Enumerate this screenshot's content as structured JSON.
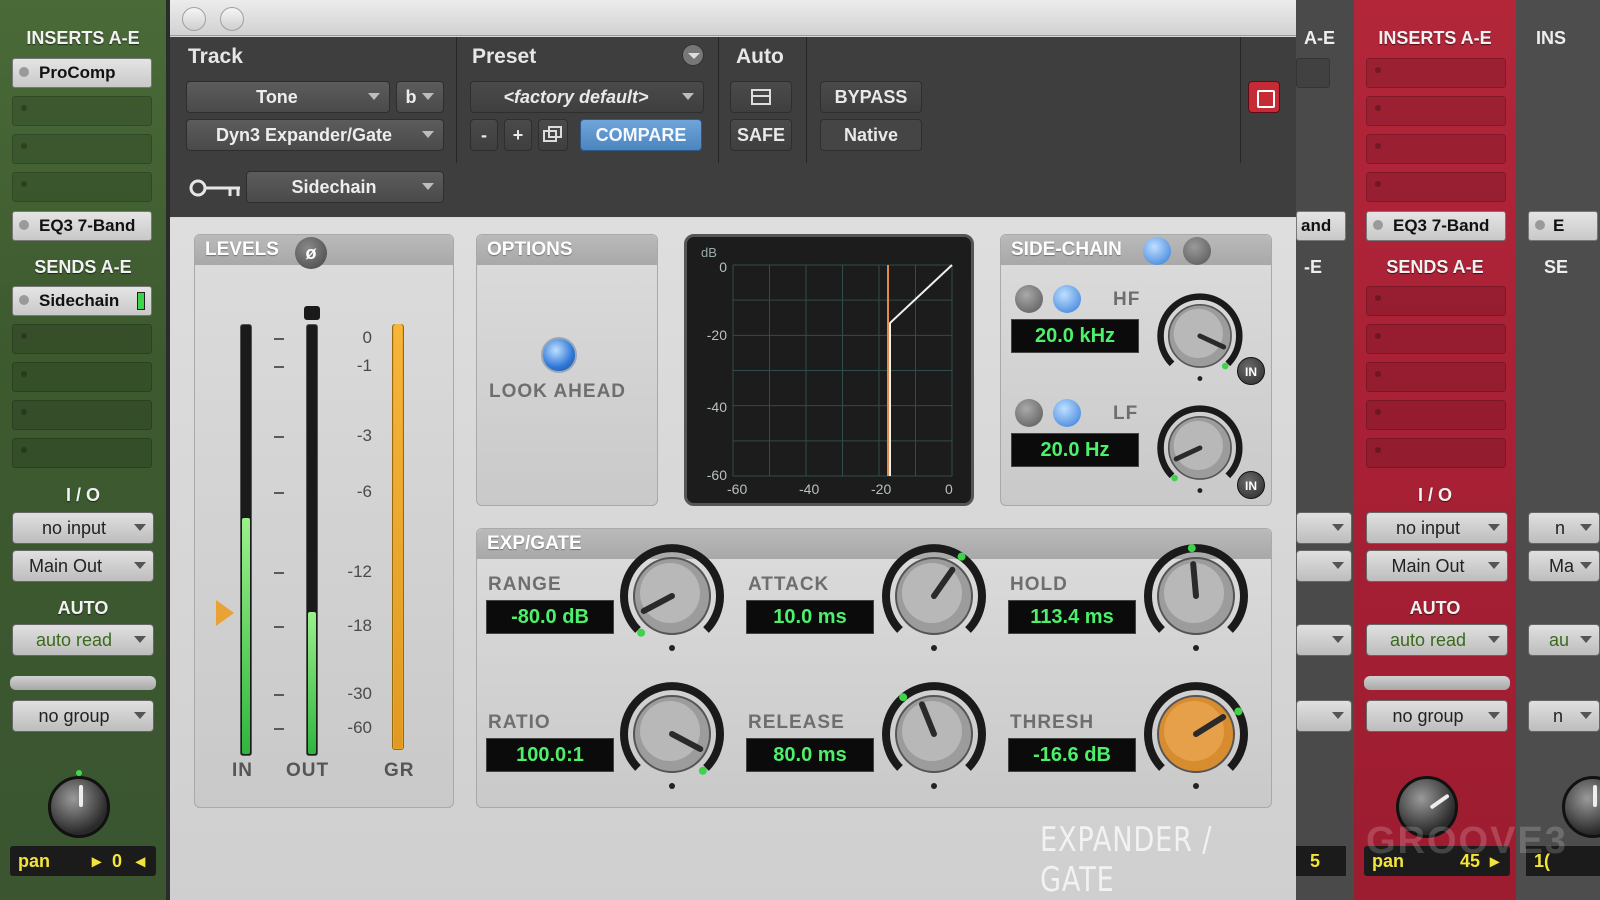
{
  "left_strip": {
    "inserts_title": "INSERTS A-E",
    "insert_1": "ProComp",
    "insert_5": "EQ3 7-Band",
    "sends_title": "SENDS A-E",
    "send_1": "Sidechain",
    "io_title": "I / O",
    "input": "no input",
    "output": "Main Out",
    "auto_title": "AUTO",
    "auto_mode": "auto read",
    "group": "no group",
    "pan_label": "pan",
    "pan_value": "0"
  },
  "mid_strip": {
    "inserts_fragment": "A-E",
    "insert_fragment": "and",
    "sends_fragment": "-E",
    "pan_value": "5"
  },
  "red_strip": {
    "inserts_title": "INSERTS A-E",
    "insert_5": "EQ3 7-Band",
    "sends_title": "SENDS A-E",
    "io_title": "I / O",
    "input": "no input",
    "output": "Main Out",
    "auto_title": "AUTO",
    "auto_mode": "auto read",
    "group": "no group",
    "pan_label": "pan",
    "pan_value": "45",
    "watermark": "GROOVE3"
  },
  "right_strip": {
    "inserts_fragment": "INS",
    "insert_fragment": "E",
    "sends_fragment": "SE",
    "input_fragment": "n",
    "output_fragment": "Ma",
    "auto_fragment": "au",
    "group_fragment": "n",
    "pan_fragment": "1("
  },
  "plugin": {
    "header": {
      "track_label": "Track",
      "preset_label": "Preset",
      "auto_label": "Auto",
      "track_name": "Tone",
      "track_variant": "b",
      "plugin_name": "Dyn3 Expander/Gate",
      "preset_name": "<factory default>",
      "minus": "-",
      "plus": "+",
      "compare": "COMPARE",
      "bypass": "BYPASS",
      "safe": "SAFE",
      "native": "Native",
      "sidechain": "Sidechain"
    },
    "levels": {
      "title": "LEVELS",
      "phase_symbol": "ø",
      "scale": [
        "0",
        "-1",
        "-3",
        "-6",
        "-12",
        "-18",
        "-30",
        "-60"
      ],
      "in_label": "IN",
      "out_label": "OUT",
      "gr_label": "GR",
      "in_level": 0.55,
      "out_level": 0.33,
      "gr_level": 1.0
    },
    "options": {
      "title": "OPTIONS",
      "look_ahead": "LOOK AHEAD"
    },
    "graph": {
      "unit": "dB",
      "y_ticks": [
        "0",
        "-20",
        "-40",
        "-60"
      ],
      "x_ticks": [
        "-60",
        "-40",
        "-20",
        "0"
      ]
    },
    "sidechain_panel": {
      "title": "SIDE-CHAIN",
      "hf_label": "HF",
      "hf_value": "20.0 kHz",
      "lf_label": "LF",
      "lf_value": "20.0 Hz",
      "in_label": "IN"
    },
    "expgate": {
      "title": "EXP/GATE",
      "range_label": "RANGE",
      "range_value": "-80.0 dB",
      "attack_label": "ATTACK",
      "attack_value": "10.0 ms",
      "hold_label": "HOLD",
      "hold_value": "113.4 ms",
      "ratio_label": "RATIO",
      "ratio_value": "100.0:1",
      "release_label": "RELEASE",
      "release_value": "80.0 ms",
      "thresh_label": "THRESH",
      "thresh_value": "-16.6 dB"
    },
    "brand": "EXPANDER / GATE"
  },
  "colors": {
    "meter_green": "#41c84a",
    "gr_orange": "#e6a02a",
    "readout_green": "#4df06a",
    "compare_blue": "#5a90c8",
    "thresh_knob": "#d88c30"
  }
}
